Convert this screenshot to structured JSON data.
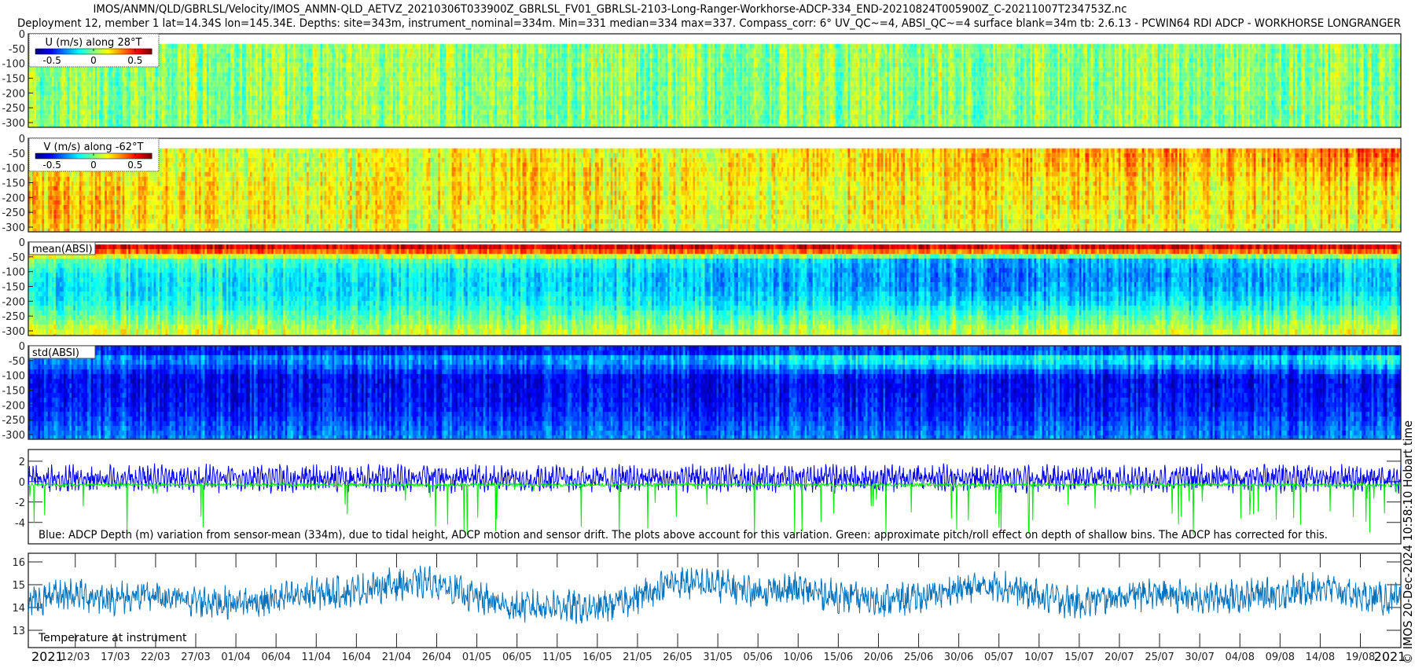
{
  "title": {
    "line1": "IMOS/ANMN/QLD/GBRLSL/Velocity/IMOS_ANMN-QLD_AETVZ_20210306T033900Z_GBRLSL_FV01_GBRLSL-2103-Long-Ranger-Workhorse-ADCP-334_END-20210824T005900Z_C-20211007T234753Z.nc",
    "line2": "Deployment 12, member 1 lat=14.34S lon=145.34E. Depths: site=343m, instrument_nominal=334m. Min=331 median=334 max=337. Compass_corr: 6° UV_QC~=4, ABSI_QC~=4 surface blank=34m tb: 2.6.13 - PCWIN64 RDI ADCP - WORKHORSE LONGRANGER"
  },
  "credit": "© IMOS 20-Dec-2024 10:58:10 Hobart time",
  "colors": {
    "colormap": "jet",
    "depth_blue": "#0000ff",
    "pitch_green": "#00ee00",
    "temperature": "#0072bd"
  },
  "chart_data": [
    {
      "type": "heatmap",
      "label": "U (m/s) along 28°T",
      "colorbar_ticks": [
        "-0.5",
        "0",
        "0.5"
      ],
      "clim": [
        -0.7,
        0.7
      ],
      "ylim": [
        -316,
        0
      ],
      "yticks": [
        "0",
        "-50",
        "-100",
        "-150",
        "-200",
        "-250",
        "-300"
      ],
      "depth_levels": [
        -50,
        -100,
        -150,
        -200,
        -250,
        -300
      ],
      "segment_values": [
        [
          0.02,
          0.03,
          0.02,
          0.03,
          0.02,
          0.03,
          0.03,
          0.02,
          0.03,
          0.03
        ],
        [
          0.02,
          0.03,
          0.02,
          0.03,
          0.02,
          0.03,
          0.03,
          0.02,
          0.03,
          0.03
        ],
        [
          0.02,
          0.02,
          0.02,
          0.03,
          0.02,
          0.02,
          0.03,
          0.02,
          0.03,
          0.03
        ],
        [
          0.02,
          0.02,
          0.02,
          0.02,
          0.02,
          0.02,
          0.02,
          0.02,
          0.02,
          0.02
        ],
        [
          0.02,
          0.02,
          0.02,
          0.02,
          0.02,
          0.02,
          0.02,
          0.02,
          0.02,
          0.02
        ],
        [
          0.02,
          0.02,
          0.02,
          0.02,
          0.02,
          0.02,
          0.02,
          0.02,
          0.02,
          0.02
        ]
      ],
      "surface_blank_m": 34
    },
    {
      "type": "heatmap",
      "label": "V (m/s) along -62°T",
      "colorbar_ticks": [
        "-0.5",
        "0",
        "0.5"
      ],
      "clim": [
        -0.7,
        0.7
      ],
      "ylim": [
        -316,
        0
      ],
      "yticks": [
        "0",
        "-50",
        "-100",
        "-150",
        "-200",
        "-250",
        "-300"
      ],
      "depth_levels": [
        -50,
        -100,
        -150,
        -200,
        -250,
        -300
      ],
      "segment_values": [
        [
          0.15,
          0.15,
          0.1,
          0.2,
          0.15,
          0.2,
          0.25,
          0.3,
          0.3,
          0.45
        ],
        [
          0.2,
          0.15,
          0.1,
          0.2,
          0.2,
          0.2,
          0.25,
          0.25,
          0.25,
          0.35
        ],
        [
          0.25,
          0.2,
          0.15,
          0.2,
          0.2,
          0.15,
          0.2,
          0.2,
          0.2,
          0.25
        ],
        [
          0.3,
          0.2,
          0.15,
          0.2,
          0.2,
          0.15,
          0.2,
          0.2,
          0.2,
          0.2
        ],
        [
          0.3,
          0.2,
          0.15,
          0.15,
          0.2,
          0.15,
          0.2,
          0.15,
          0.2,
          0.2
        ],
        [
          0.25,
          0.15,
          0.1,
          0.15,
          0.15,
          0.1,
          0.15,
          0.15,
          0.15,
          0.15
        ]
      ],
      "surface_blank_m": 34
    },
    {
      "type": "heatmap",
      "label": "mean(ABSI)",
      "clim": [
        0,
        1
      ],
      "ylim": [
        -316,
        0
      ],
      "yticks": [
        "0",
        "-50",
        "-100",
        "-150",
        "-200",
        "-250",
        "-300"
      ],
      "depth_levels": [
        -15,
        -50,
        -100,
        -150,
        -200,
        -250,
        -300
      ],
      "segment_values": [
        [
          0.9,
          0.9,
          0.9,
          0.9,
          0.9,
          0.9,
          0.9,
          0.9,
          0.9,
          0.9
        ],
        [
          0.5,
          0.45,
          0.45,
          0.45,
          0.4,
          0.35,
          0.3,
          0.3,
          0.35,
          0.4
        ],
        [
          0.4,
          0.38,
          0.38,
          0.36,
          0.33,
          0.3,
          0.25,
          0.25,
          0.28,
          0.33
        ],
        [
          0.36,
          0.36,
          0.36,
          0.35,
          0.33,
          0.3,
          0.27,
          0.27,
          0.3,
          0.33
        ],
        [
          0.4,
          0.4,
          0.4,
          0.4,
          0.38,
          0.36,
          0.35,
          0.35,
          0.37,
          0.4
        ],
        [
          0.5,
          0.5,
          0.48,
          0.48,
          0.48,
          0.47,
          0.47,
          0.47,
          0.48,
          0.5
        ],
        [
          0.62,
          0.6,
          0.58,
          0.58,
          0.58,
          0.57,
          0.57,
          0.57,
          0.58,
          0.6
        ]
      ],
      "surface_blank_m": 8
    },
    {
      "type": "heatmap",
      "label": "std(ABSI)",
      "clim": [
        0,
        1
      ],
      "ylim": [
        -316,
        0
      ],
      "yticks": [
        "0",
        "-50",
        "-100",
        "-150",
        "-200",
        "-250",
        "-300"
      ],
      "depth_levels": [
        -15,
        -35,
        -100,
        -150,
        -200,
        -250,
        -300
      ],
      "segment_values": [
        [
          0.15,
          0.15,
          0.15,
          0.15,
          0.15,
          0.18,
          0.2,
          0.2,
          0.18,
          0.2
        ],
        [
          0.28,
          0.28,
          0.28,
          0.3,
          0.3,
          0.4,
          0.45,
          0.4,
          0.35,
          0.45
        ],
        [
          0.12,
          0.12,
          0.12,
          0.12,
          0.12,
          0.12,
          0.12,
          0.12,
          0.12,
          0.12
        ],
        [
          0.13,
          0.13,
          0.13,
          0.13,
          0.13,
          0.13,
          0.13,
          0.13,
          0.13,
          0.13
        ],
        [
          0.15,
          0.15,
          0.15,
          0.15,
          0.15,
          0.15,
          0.15,
          0.15,
          0.15,
          0.15
        ],
        [
          0.2,
          0.2,
          0.2,
          0.2,
          0.2,
          0.2,
          0.2,
          0.2,
          0.2,
          0.2
        ],
        [
          0.25,
          0.25,
          0.25,
          0.25,
          0.25,
          0.25,
          0.25,
          0.25,
          0.25,
          0.25
        ]
      ],
      "surface_blank_m": 0
    },
    {
      "type": "line",
      "annotation": "Blue: ADCP Depth (m) variation from sensor-mean (334m), due to tidal height, ADCP motion and sensor drift. The plots above account for this variation. Green: approximate pitch/roll effect on depth of shallow bins. The ADCP has corrected for this.",
      "ylim": [
        -6.1,
        3.15
      ],
      "yticks": [
        "2",
        "0",
        "-2",
        "-4"
      ],
      "series": [
        {
          "color": "#0000ff",
          "mean": 0.3,
          "range": [
            -2.5,
            2.8
          ]
        },
        {
          "color": "#00ee00",
          "mean": -0.3,
          "range": [
            -6.0,
            0.3
          ]
        }
      ]
    },
    {
      "type": "line",
      "annotation": "Temperature at instrument",
      "ylim": [
        12.24,
        16.38
      ],
      "yticks": [
        "16",
        "15",
        "14",
        "13"
      ],
      "x_step_days": 5,
      "values": [
        14.2,
        14.6,
        14.4,
        14.5,
        14.3,
        14.2,
        14.3,
        14.6,
        14.7,
        15.0,
        15.1,
        14.5,
        14.0,
        14.1,
        13.9,
        14.4,
        15.1,
        15.0,
        14.7,
        14.8,
        14.5,
        14.3,
        14.4,
        14.8,
        15.0,
        14.5,
        14.2,
        14.5,
        14.6,
        14.4,
        14.5,
        14.6,
        14.9,
        14.5,
        14.3
      ]
    }
  ],
  "x_axis": {
    "range": [
      "2021-03-06T03:39:00",
      "2021-08-24T00:59:00"
    ],
    "year_left": "2021",
    "year_right": "2021",
    "tick_dates": [
      "12/03",
      "17/03",
      "22/03",
      "27/03",
      "01/04",
      "06/04",
      "11/04",
      "16/04",
      "21/04",
      "26/04",
      "01/05",
      "06/05",
      "11/05",
      "16/05",
      "21/05",
      "26/05",
      "31/05",
      "05/06",
      "10/06",
      "15/06",
      "20/06",
      "25/06",
      "30/06",
      "05/07",
      "10/07",
      "15/07",
      "20/07",
      "25/07",
      "30/07",
      "04/08",
      "09/08",
      "14/08",
      "19/08"
    ]
  }
}
